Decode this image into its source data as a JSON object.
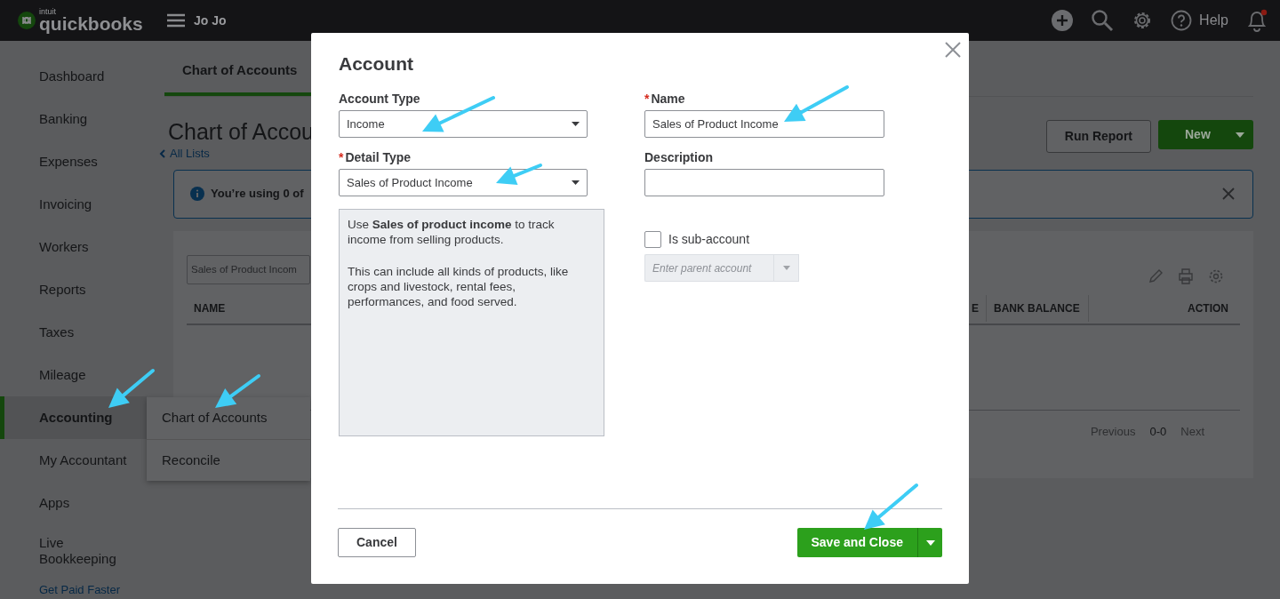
{
  "topbar": {
    "brand_small": "intuit",
    "brand": "quickbooks",
    "company": "Jo Jo",
    "help": "Help",
    "has_notifications": true
  },
  "sidebar": {
    "items": [
      {
        "label": "Dashboard",
        "selected": false
      },
      {
        "label": "Banking",
        "selected": false
      },
      {
        "label": "Expenses",
        "selected": false
      },
      {
        "label": "Invoicing",
        "selected": false
      },
      {
        "label": "Workers",
        "selected": false
      },
      {
        "label": "Reports",
        "selected": false
      },
      {
        "label": "Taxes",
        "selected": false
      },
      {
        "label": "Mileage",
        "selected": false
      },
      {
        "label": "Accounting",
        "selected": true
      },
      {
        "label": "My Accountant",
        "selected": false
      },
      {
        "label": "Apps",
        "selected": false
      },
      {
        "label": "Live Bookkeeping",
        "selected": false
      }
    ],
    "promo": "Get Paid Faster",
    "flyout": [
      {
        "label": "Chart of Accounts"
      },
      {
        "label": "Reconcile"
      }
    ]
  },
  "page": {
    "tab": {
      "label": "Chart of Accounts",
      "selected": true
    },
    "title": "Chart of Accou",
    "back_link": "All Lists",
    "run_report": "Run Report",
    "new_button": "New",
    "banner": "You’re using 0 of",
    "search": {
      "placeholder": "Sales of Product Incom"
    },
    "columns": [
      "NAME",
      "E",
      "BANK BALANCE",
      "ACTION"
    ],
    "pagination": {
      "previous": "Previous",
      "range": "0-0",
      "next": "Next"
    }
  },
  "modal": {
    "title": "Account",
    "account_type": {
      "label": "Account Type",
      "value": "Income"
    },
    "detail_type": {
      "label": "Detail Type",
      "required_mark": "*",
      "value": "Sales of Product Income"
    },
    "name": {
      "label": "Name",
      "required_mark": "*",
      "value": "Sales of Product Income"
    },
    "description": {
      "label": "Description"
    },
    "help_text": [
      "Use **Sales of product income** to track income from selling products.",
      "This can include all kinds of products, like crops and livestock, rental fees, performances, and food served."
    ],
    "sub_account": {
      "label": "Is sub-account",
      "checked": false
    },
    "parent_account": {
      "placeholder": "Enter parent account",
      "disabled": true
    },
    "cancel": "Cancel",
    "save": "Save and Close"
  }
}
